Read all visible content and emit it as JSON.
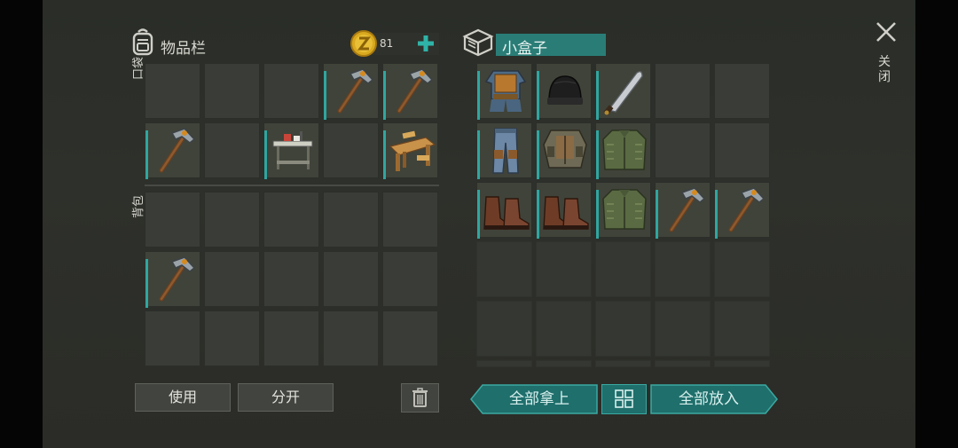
{
  "left_panel": {
    "title": "物品栏",
    "icon": "backpack-icon",
    "coins": "81",
    "pocket_label": "口袋",
    "backpack_label": "背包",
    "use_button": "使用",
    "split_button": "分开",
    "pocket_slots": [
      "",
      "",
      "",
      "pickaxe",
      "pickaxe",
      "pickaxe",
      "",
      "workbench-table",
      "",
      "wood-workbench"
    ],
    "backpack_slots": [
      "",
      "",
      "",
      "",
      "",
      "pickaxe",
      "",
      "",
      "",
      "",
      "",
      "",
      "",
      "",
      ""
    ]
  },
  "right_panel": {
    "title": "小盒子",
    "icon": "box-icon",
    "take_all_button": "全部拿上",
    "put_all_button": "全部放入",
    "slots": [
      "armor-vest",
      "beanie-hat",
      "machete",
      "",
      "",
      "pants",
      "tactical-vest",
      "green-jacket",
      "",
      "",
      "boots",
      "boots",
      "green-jacket",
      "pickaxe",
      "pickaxe"
    ]
  },
  "close_label": "关闭",
  "colors": {
    "accent": "#2fa6a0",
    "button_teal": "#1f6f6c"
  }
}
